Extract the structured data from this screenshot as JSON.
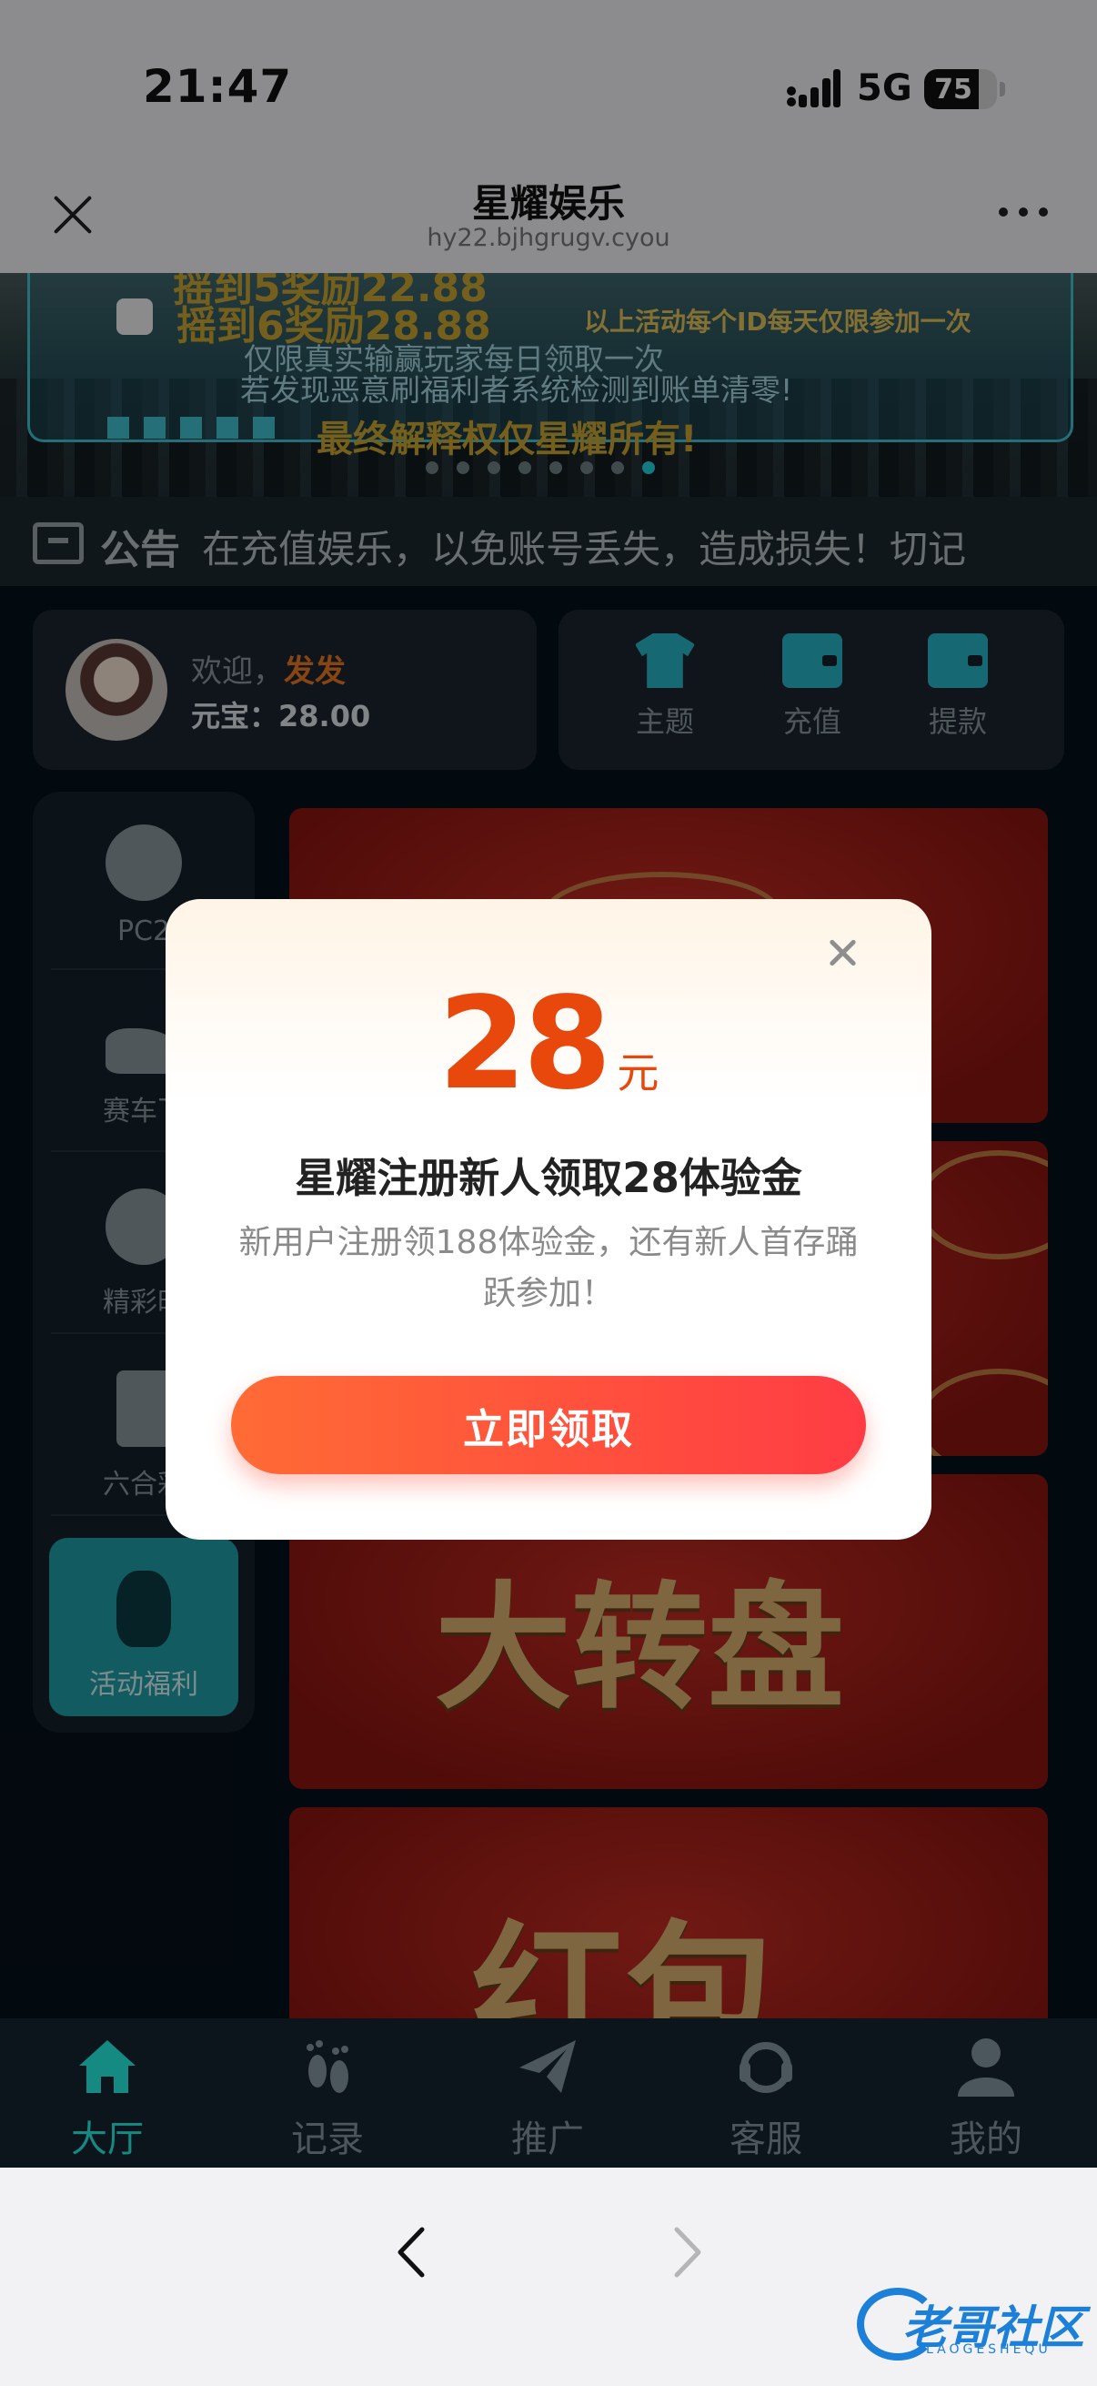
{
  "status_bar": {
    "time": "21:47",
    "network": "5G",
    "battery": "75"
  },
  "nav": {
    "title": "星耀娱乐",
    "url": "hy22.bjhgrugv.cyou"
  },
  "banner": {
    "line1": "摇到5奖励22.88",
    "line2": "摇到6奖励28.88",
    "right_note": "以上活动每个ID每天仅限参加一次",
    "line3": "仅限真实输赢玩家每日领取一次",
    "line4": "若发现恶意刷福利者系统检测到账单清零!",
    "line5": "最终解释权仅星耀所有!",
    "dot_count": 8,
    "active_dot": 7
  },
  "notice": {
    "label": "公告",
    "text": "在充值娱乐，以免账号丢失，造成损失！切记"
  },
  "user": {
    "welcome_prefix": "欢迎，",
    "name": "发发",
    "balance": "元宝：28.00"
  },
  "actions": [
    {
      "label": "主题",
      "icon": "shirt-icon"
    },
    {
      "label": "充值",
      "icon": "wallet-icon"
    },
    {
      "label": "提款",
      "icon": "wallet-withdraw-icon"
    }
  ],
  "sidebar": [
    {
      "label": "PC2",
      "icon": "eight-ball-icon"
    },
    {
      "label": "赛车飞",
      "icon": "speedboat-icon"
    },
    {
      "label": "精彩时",
      "icon": "lottery-ball-icon"
    },
    {
      "label": "六合彩",
      "icon": "playing-card-icon"
    },
    {
      "label": "活动福利",
      "icon": "dancer-icon",
      "active": true
    }
  ],
  "promos": [
    {
      "name": "banner-promo-1"
    },
    {
      "name": "banner-promo-2"
    },
    {
      "name": "banner-wheel",
      "text": "大转盘"
    },
    {
      "name": "banner-redpacket",
      "text": "红包"
    }
  ],
  "modal": {
    "amount": "28",
    "unit": "元",
    "title": "星耀注册新人领取28体验金",
    "desc": "新用户注册领188体验金，还有新人首存踊跃参加！",
    "button": "立即领取"
  },
  "tabs": [
    {
      "label": "大厅",
      "icon": "home-icon",
      "active": true
    },
    {
      "label": "记录",
      "icon": "footprint-icon"
    },
    {
      "label": "推广",
      "icon": "paper-plane-icon"
    },
    {
      "label": "客服",
      "icon": "headset-icon"
    },
    {
      "label": "我的",
      "icon": "user-icon"
    }
  ],
  "watermark": {
    "text": "老哥社区",
    "sub": "LAOGESHEQU"
  },
  "colors": {
    "accent": "#1fb3a8",
    "modal_amount": "#e8480c",
    "button": "#ff4b3e"
  }
}
